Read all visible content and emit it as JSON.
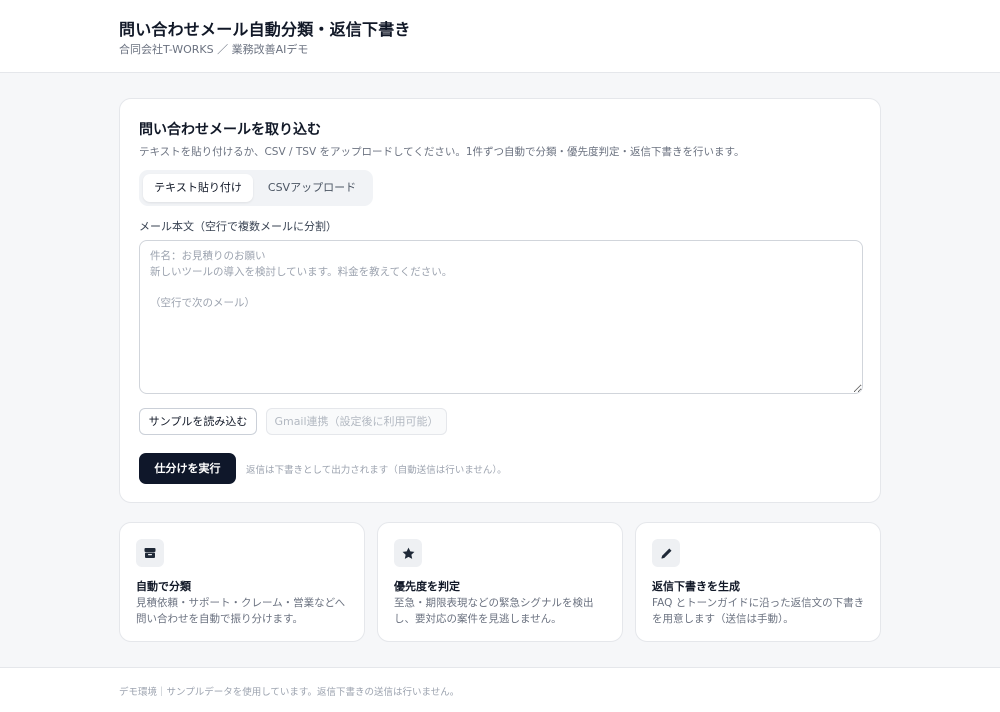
{
  "header": {
    "title": "問い合わせメール自動分類・返信下書き",
    "subtitle": "合同会社T-WORKS ／ 業務改善AIデモ"
  },
  "import": {
    "title": "問い合わせメールを取り込む",
    "description": "テキストを貼り付けるか、CSV / TSV をアップロードしてください。1件ずつ自動で分類・優先度判定・返信下書きを行います。",
    "tabs": [
      {
        "label": "テキスト貼り付け",
        "active": true
      },
      {
        "label": "CSVアップロード",
        "active": false
      }
    ],
    "field_label": "メール本文（空行で複数メールに分割）",
    "textarea_value": "",
    "textarea_placeholder": "件名：お見積りのお願い\n新しいツールの導入を検討しています。料金を教えてください。\n\n（空行で次のメール）",
    "sample_button": "サンプルを読み込む",
    "gmail_button": "Gmail連携（設定後に利用可能）",
    "run_button": "仕分けを実行",
    "run_note": "返信は下書きとして出力されます（自動送信は行いません）。"
  },
  "features": [
    {
      "icon": "inbox-icon",
      "title": "自動で分類",
      "description": "見積依頼・サポート・クレーム・営業などへ問い合わせを自動で振り分けます。"
    },
    {
      "icon": "star-icon",
      "title": "優先度を判定",
      "description": "至急・期限表現などの緊急シグナルを検出し、要対応の案件を見逃しません。"
    },
    {
      "icon": "pencil-icon",
      "title": "返信下書きを生成",
      "description": "FAQ とトーンガイドに沿った返信文の下書きを用意します（送信は手動）。"
    }
  ],
  "footer": {
    "text": "デモ環境｜サンプルデータを使用しています。返信下書きの送信は行いません。"
  },
  "colors": {
    "primary": "#0f172a",
    "background": "#f6f7f9",
    "muted_text": "#6b7280"
  }
}
